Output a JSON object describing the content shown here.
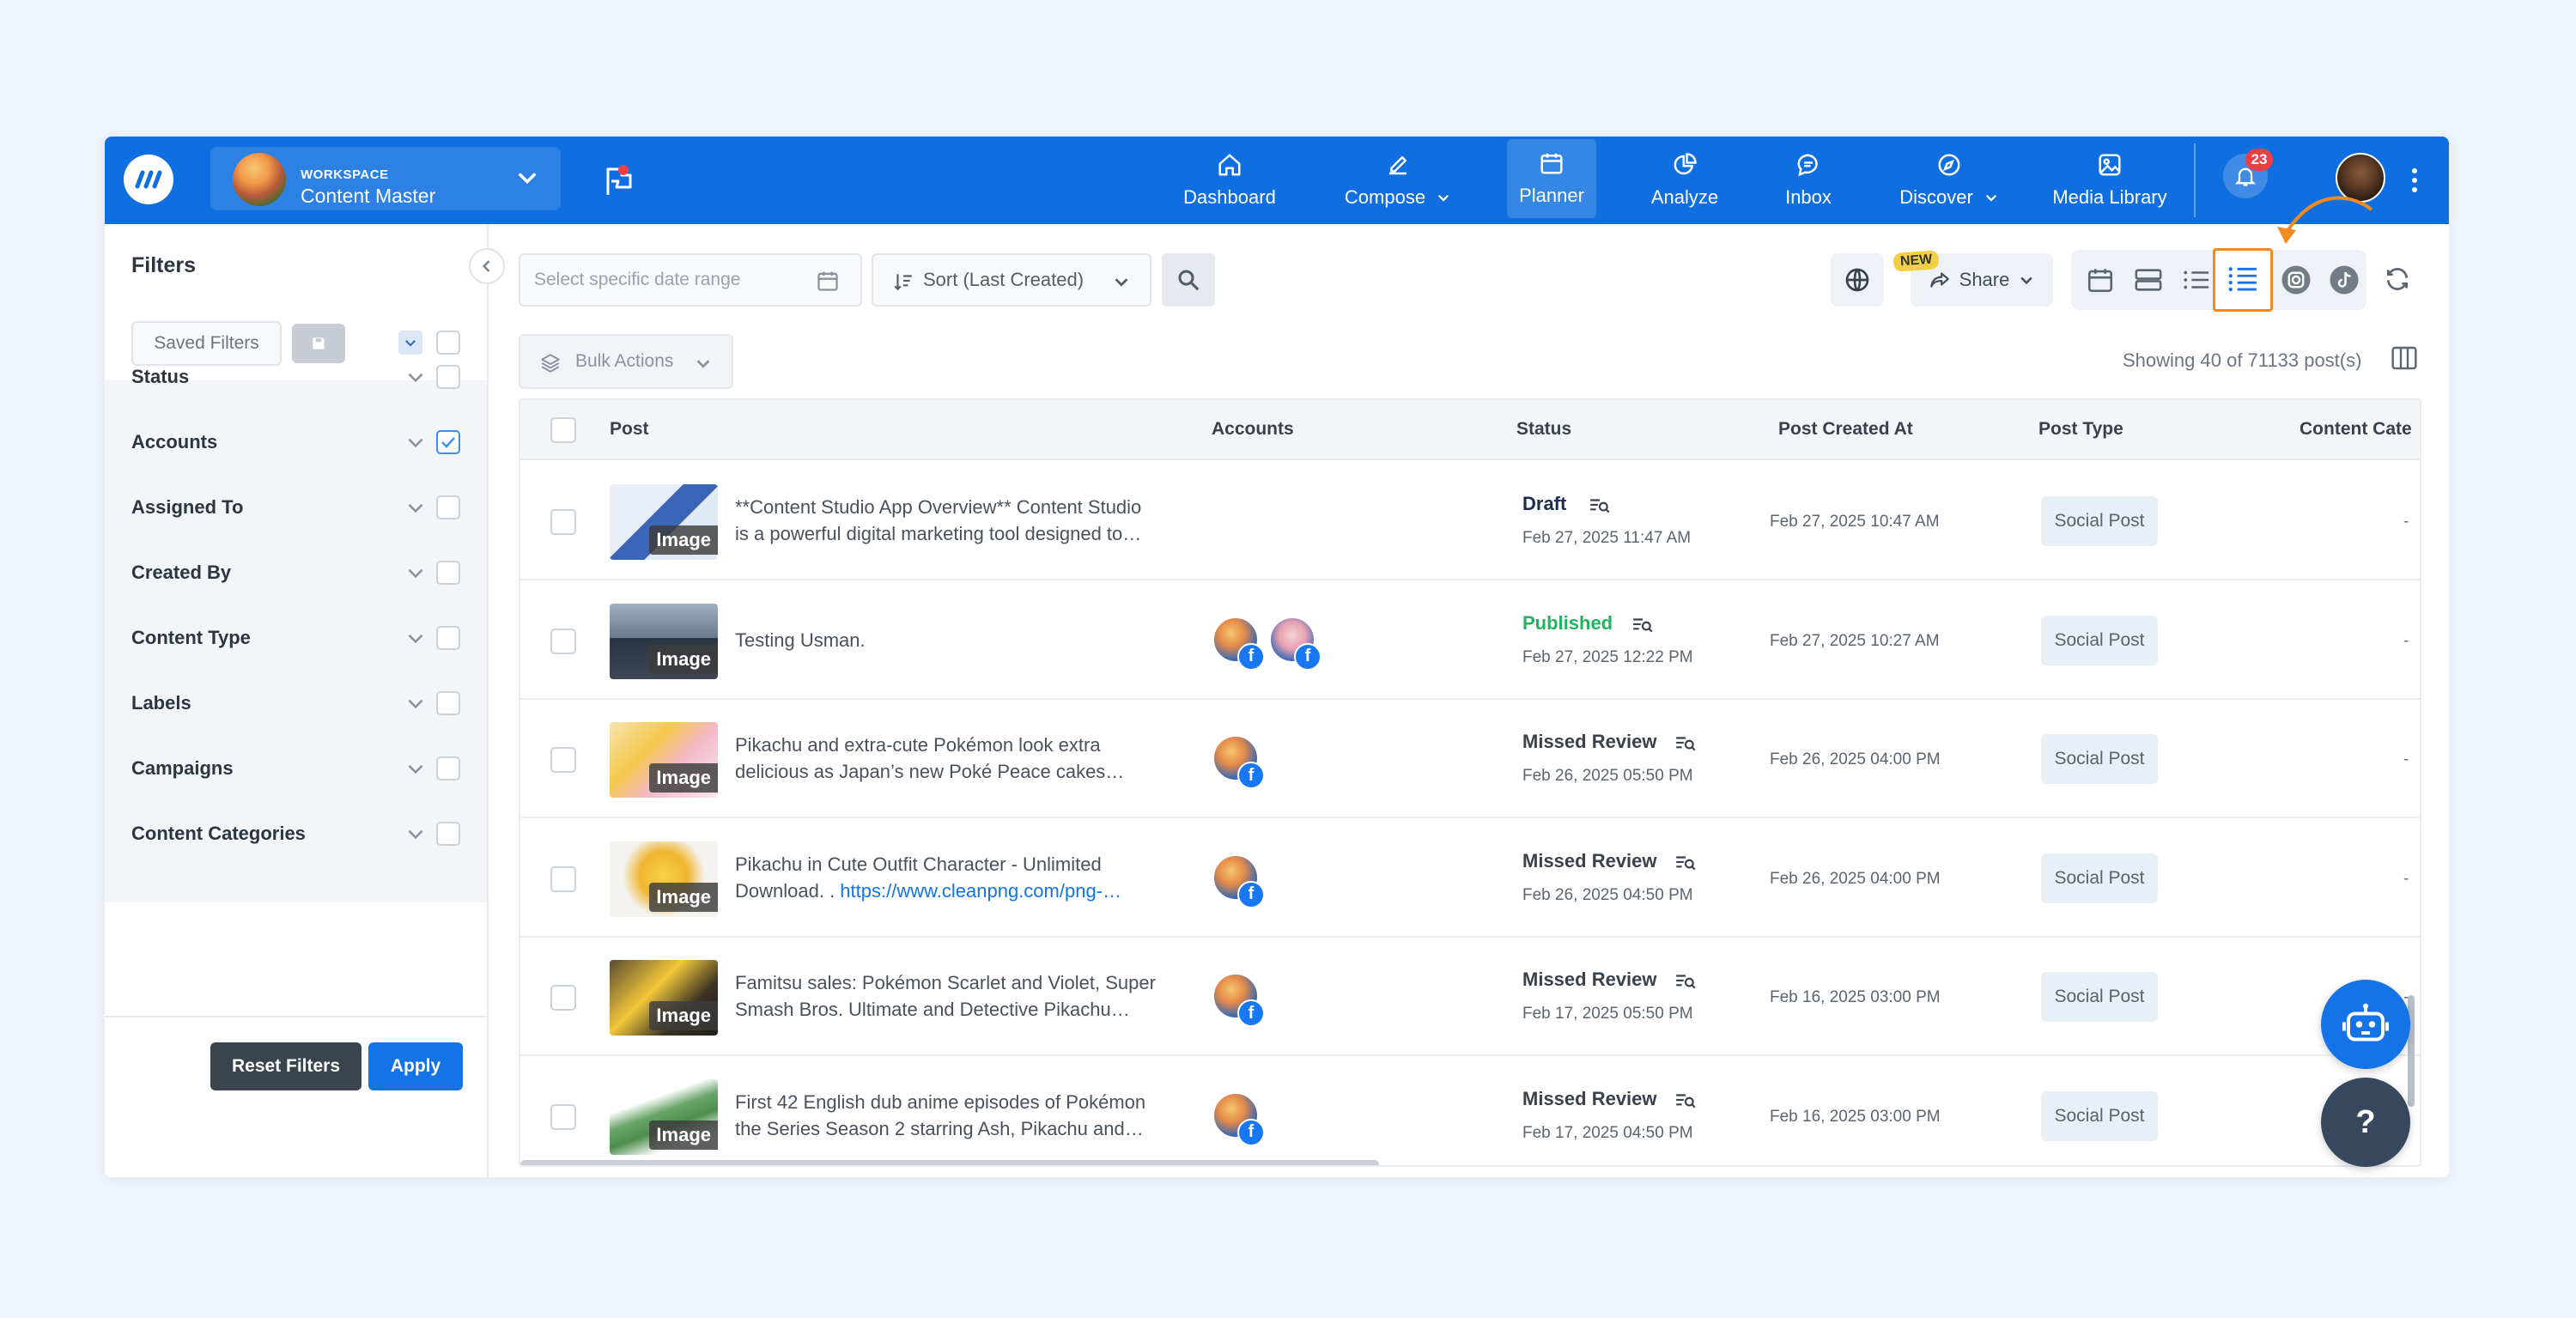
{
  "workspace": {
    "label": "WORKSPACE",
    "name": "Content Master"
  },
  "nav": [
    {
      "label": "Dashboard",
      "icon": "home-icon"
    },
    {
      "label": "Compose",
      "icon": "pencil-icon"
    },
    {
      "label": "Planner",
      "icon": "calendar-icon"
    },
    {
      "label": "Analyze",
      "icon": "pie-chart-icon"
    },
    {
      "label": "Inbox",
      "icon": "chat-icon"
    },
    {
      "label": "Discover",
      "icon": "compass-icon"
    },
    {
      "label": "Media Library",
      "icon": "image-icon"
    }
  ],
  "notifications": {
    "count": "23"
  },
  "sidebar": {
    "title": "Filters",
    "saved_filters": "Saved Filters",
    "filters": [
      {
        "label": "Status",
        "checked": false
      },
      {
        "label": "Accounts",
        "checked": true
      },
      {
        "label": "Assigned To",
        "checked": false
      },
      {
        "label": "Created By",
        "checked": false
      },
      {
        "label": "Content Type",
        "checked": false
      },
      {
        "label": "Labels",
        "checked": false
      },
      {
        "label": "Campaigns",
        "checked": false
      },
      {
        "label": "Content Categories",
        "checked": false
      }
    ],
    "reset_label": "Reset Filters",
    "apply_label": "Apply"
  },
  "toolbar": {
    "date_placeholder": "Select specific date range",
    "sort_label": "Sort (Last Created)",
    "new_badge": "NEW",
    "share_label": "Share",
    "bulk_label": "Bulk Actions",
    "showing": "Showing 40 of 71133 post(s)"
  },
  "table": {
    "headers": [
      "Post",
      "Accounts",
      "Status",
      "Post Created At",
      "Post Type",
      "Content Cate"
    ],
    "image_tag": "Image",
    "rows": [
      {
        "line1": "**Content Studio App Overview** Content Studio",
        "line2": "is a powerful digital marketing tool designed to…",
        "link": "",
        "accounts": 0,
        "status": "Draft",
        "status_color": "#1d2b4f",
        "status_date": "Feb 27, 2025 11:47 AM",
        "created": "Feb 27, 2025 10:47 AM",
        "type": "Social Post",
        "cat": "-"
      },
      {
        "line1": "Testing Usman.",
        "line2": "",
        "link": "",
        "accounts": 2,
        "status": "Published",
        "status_color": "#21b35f",
        "status_date": "Feb 27, 2025 12:22 PM",
        "created": "Feb 27, 2025 10:27 AM",
        "type": "Social Post",
        "cat": "-"
      },
      {
        "line1": "Pikachu and extra-cute Pokémon look extra",
        "line2": "delicious as Japan’s new Poké Peace cakes…",
        "link": "",
        "accounts": 1,
        "status": "Missed Review",
        "status_color": "#3a414b",
        "status_date": "Feb 26, 2025 05:50 PM",
        "created": "Feb 26, 2025 04:00 PM",
        "type": "Social Post",
        "cat": "-"
      },
      {
        "line1": "Pikachu in Cute Outfit Character - Unlimited",
        "line2": "Download. . ",
        "link": "https://www.cleanpng.com/png-…",
        "accounts": 1,
        "status": "Missed Review",
        "status_color": "#3a414b",
        "status_date": "Feb 26, 2025 04:50 PM",
        "created": "Feb 26, 2025 04:00 PM",
        "type": "Social Post",
        "cat": "-"
      },
      {
        "line1": "Famitsu sales: Pokémon Scarlet and Violet, Super",
        "line2": "Smash Bros. Ultimate and Detective Pikachu…",
        "link": "",
        "accounts": 1,
        "status": "Missed Review",
        "status_color": "#3a414b",
        "status_date": "Feb 17, 2025 05:50 PM",
        "created": "Feb 16, 2025 03:00 PM",
        "type": "Social Post",
        "cat": "-"
      },
      {
        "line1": "First 42 English dub anime episodes of Pokémon",
        "line2": "the Series Season 2 starring Ash, Pikachu and…",
        "link": "",
        "accounts": 1,
        "status": "Missed Review",
        "status_color": "#3a414b",
        "status_date": "Feb 17, 2025 04:50 PM",
        "created": "Feb 16, 2025 03:00 PM",
        "type": "Social Post",
        "cat": "-"
      }
    ]
  },
  "help_label": "?",
  "colors": {
    "brand": "#0f6fe0",
    "accent": "#1473e6",
    "highlight": "#f28a1e"
  }
}
